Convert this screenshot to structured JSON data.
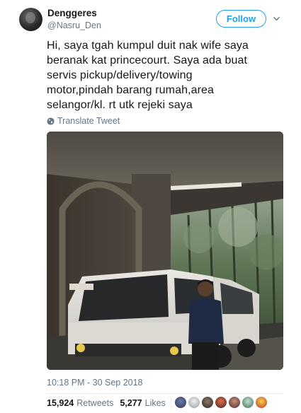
{
  "user": {
    "display_name": "Denggeres",
    "handle": "@Nasru_Den"
  },
  "follow_label": "Follow",
  "tweet": {
    "lines": [
      "Hi, saya tgah kumpul duit nak wife saya",
      "beranak kat princecourt. Saya ada buat",
      "servis pickup/delivery/towing",
      "motor,pindah barang rumah,area",
      "selangor/kl. rt utk rejeki saya"
    ]
  },
  "translate_label": "Translate Tweet",
  "timestamp": "10:18 PM - 30 Sep 2018",
  "stats": {
    "retweets_count": "15,924",
    "retweets_label": "Retweets",
    "likes_count": "5,277",
    "likes_label": "Likes"
  },
  "colors": {
    "accent": "#1da1f2",
    "secondary_text": "#657786",
    "primary_text": "#14171a"
  },
  "icons": {
    "more": "chevron-down-icon",
    "translate": "globe-icon"
  },
  "liker_avatar_count": 7
}
